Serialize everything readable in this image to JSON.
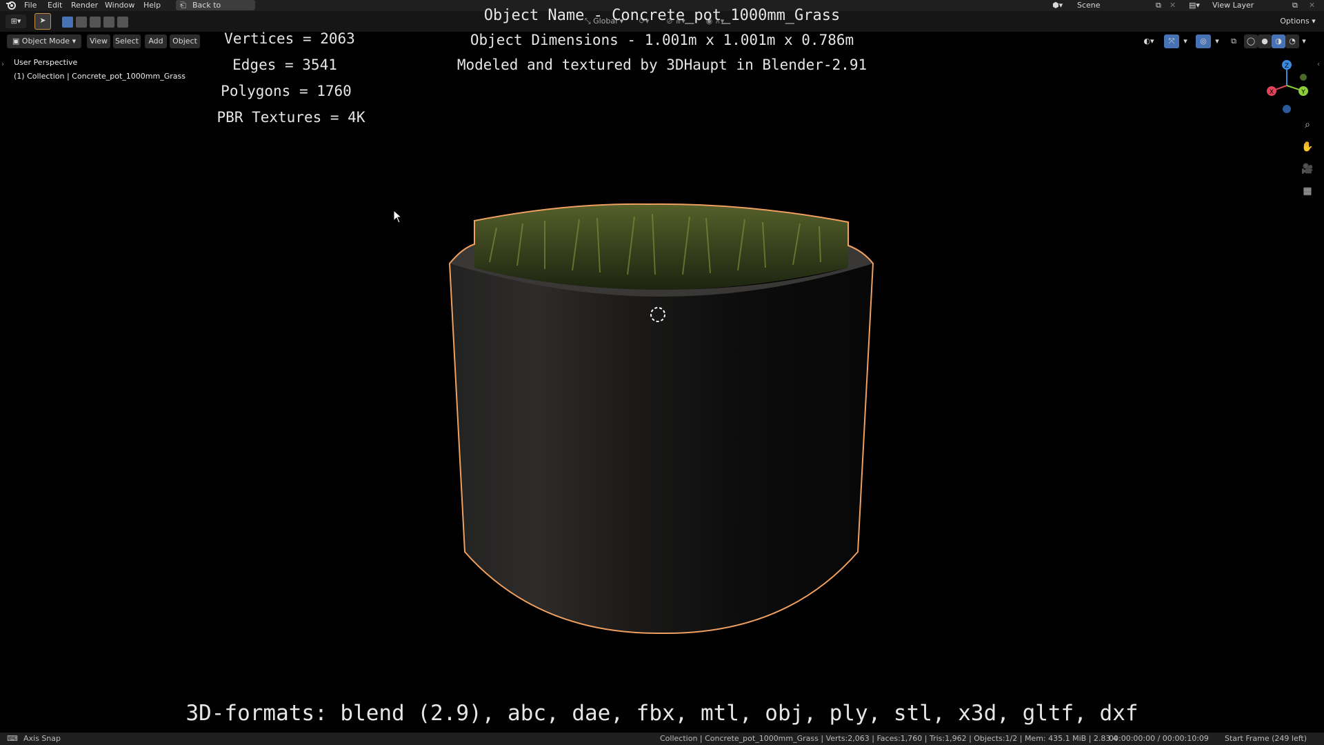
{
  "menu": {
    "items": [
      "File",
      "Edit",
      "Render",
      "Window",
      "Help"
    ],
    "back_label": "Back to Previous",
    "scene_label": "Scene",
    "view_layer_label": "View Layer"
  },
  "header": {
    "mode_label": "Object Mode",
    "view_label": "View",
    "select_label": "Select",
    "add_label": "Add",
    "object_label": "Object",
    "orientation_label": "Global",
    "options_label": "Options"
  },
  "viewport": {
    "perspective_label": "User Perspective",
    "collection_label": "(1) Collection | Concrete_pot_1000mm_Grass"
  },
  "overlay": {
    "object_name": "Object Name - Concrete_pot_1000mm_Grass",
    "dimensions": "Object Dimensions -  1.001m x 1.001m x 0.786m",
    "credits": "Modeled and textured by 3DHaupt in Blender-2.91",
    "vertices": "Vertices = 2063",
    "edges": "Edges = 3541",
    "polygons": "Polygons = 1760",
    "textures": "PBR Textures = 4K",
    "formats": "3D-formats: blend (2.9), abc, dae, fbx, mtl, obj, ply, stl, x3d, gltf, dxf"
  },
  "gizmo": {
    "x_label": "X",
    "y_label": "Y",
    "z_label": "Z",
    "x_color": "#e0445a",
    "y_color": "#8ccf3a",
    "z_color": "#3a8be0"
  },
  "status": {
    "left_label": "Axis Snap",
    "stats": "Collection | Concrete_pot_1000mm_Grass | Verts:2,063 | Faces:1,760 | Tris:1,962 | Objects:1/2 | Mem: 435.1 MiB | 2.83.4",
    "time": "00:00:00:00 / 00:00:10:09",
    "frame": "Start Frame (249 left)"
  },
  "colors": {
    "selection_outline": "#f0a060",
    "ui_bg": "#1f1f1f",
    "accent_blue": "#4772b3"
  }
}
